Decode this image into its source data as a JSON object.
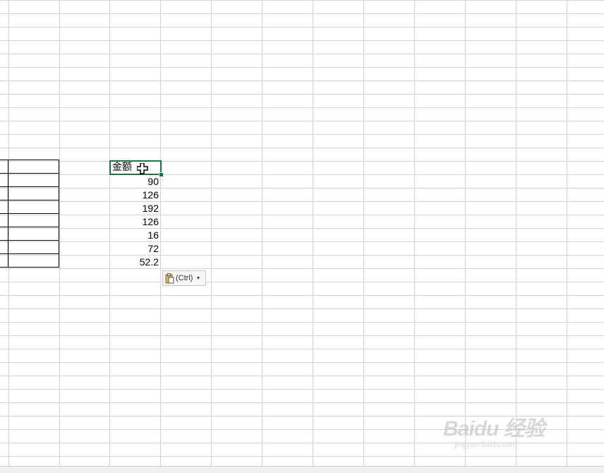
{
  "sheet": {
    "header_cell": "金额",
    "values": [
      "90",
      "126",
      "192",
      "126",
      "16",
      "72",
      "52.2"
    ]
  },
  "paste_options": {
    "label": "(Ctrl)",
    "icon": "clipboard-icon"
  },
  "watermark": {
    "title": "Baidu 经验",
    "url": "jingyan.baidu.com"
  },
  "colors": {
    "gridline": "#d4d4d4",
    "selection": "#217346",
    "border": "#000000"
  }
}
